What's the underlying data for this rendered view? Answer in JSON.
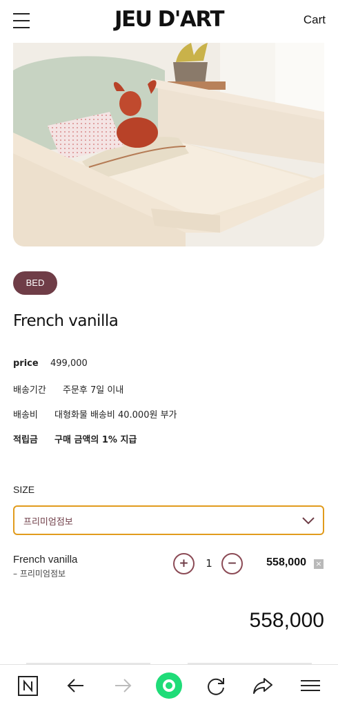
{
  "header": {
    "logo": "JEU D'ART",
    "cart_label": "Cart"
  },
  "product": {
    "image_alt": "French vanilla bed",
    "badge": "BED",
    "title": "French vanilla",
    "info": {
      "price_label": "price",
      "price_value": "499,000",
      "shipping_period_label": "배송기간",
      "shipping_period_value": "주문후 7일 이내",
      "shipping_fee_label": "배송비",
      "shipping_fee_value": "대형화물 배송비 40.000원 부가",
      "points_label": "적립금",
      "points_value": "구매 금액의 1% 지급"
    }
  },
  "size": {
    "label": "SIZE",
    "selected": "프리미엄점보"
  },
  "selected_item": {
    "name": "French vanilla",
    "option": "– 프리미엄점보",
    "quantity": "1",
    "plus": "+",
    "minus": "−",
    "price": "558,000",
    "remove": "×"
  },
  "total": "558,000",
  "browser_bar": {
    "items": [
      "naver-home-icon",
      "back-arrow-icon",
      "forward-arrow-icon",
      "green-dot-icon",
      "reload-icon",
      "share-icon",
      "menu-icon"
    ]
  },
  "colors": {
    "accent": "#6f3d47",
    "select_border": "#e19b1c",
    "green": "#1fdc78"
  }
}
